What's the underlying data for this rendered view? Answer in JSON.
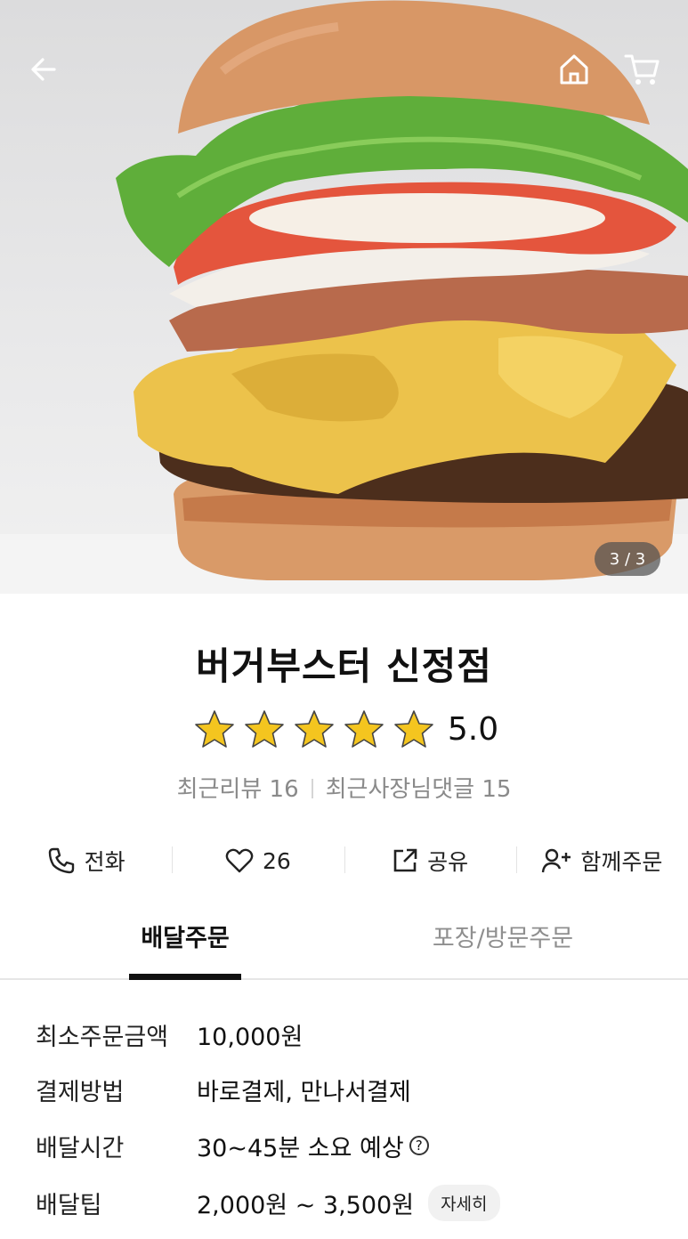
{
  "header": {
    "back_icon": "arrow-left-icon",
    "home_icon": "home-icon",
    "cart_icon": "cart-icon",
    "image_counter": "3 / 3"
  },
  "store": {
    "name": "버거부스터 신정점",
    "rating_value": "5.0",
    "rating_stars": 5,
    "recent_reviews": "최근리뷰 16",
    "owner_replies": "최근사장님댓글 15"
  },
  "actions": {
    "call_label": "전화",
    "like_count": "26",
    "share_label": "공유",
    "group_order_label": "함께주문"
  },
  "tabs": [
    {
      "label": "배달주문",
      "active": true
    },
    {
      "label": "포장/방문주문",
      "active": false
    }
  ],
  "delivery_info": [
    {
      "key": "최소주문금액",
      "value": "10,000원"
    },
    {
      "key": "결제방법",
      "value": "바로결제, 만나서결제"
    },
    {
      "key": "배달시간",
      "value": "30~45분 소요 예상"
    },
    {
      "key": "배달팁",
      "value": "2,000원 ~ 3,500원"
    }
  ],
  "help_icon_text": "?",
  "detail_button": "자세히",
  "colors": {
    "star": "#f4c51f",
    "active_tab": "#111111",
    "inactive_tab": "#8f8f8f"
  }
}
